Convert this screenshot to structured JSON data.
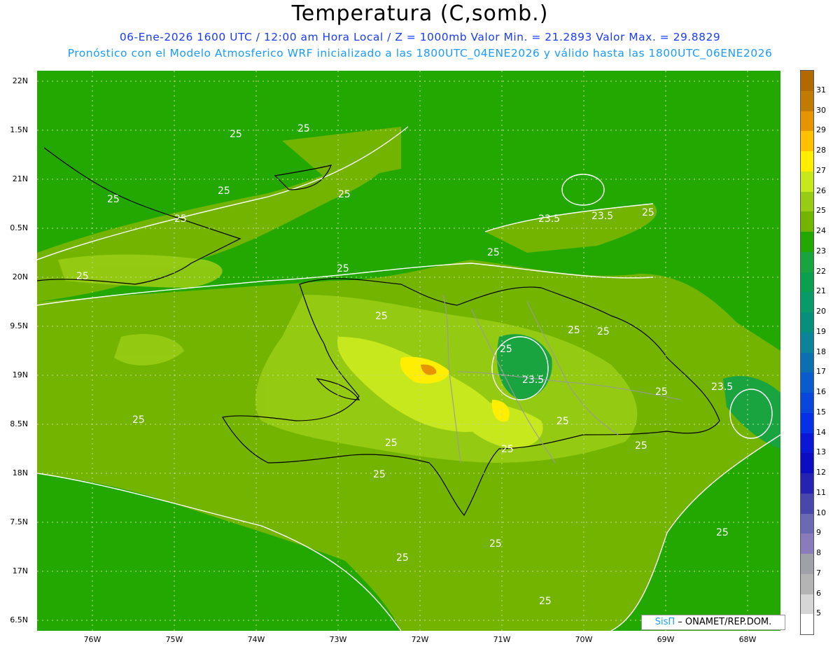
{
  "title": "Temperatura (C,somb.)",
  "subtitle_line1": "06-Ene-2026 1600 UTC / 12:00 am Hora Local / Z = 1000mb  Valor Min. = 21.2893  Valor Max. = 29.8829",
  "subtitle_line2": "Pronóstico con el Modelo Atmosferico WRF inicializado a las 1800UTC_04ENE2026 y válido hasta las  1800UTC_06ENE2026",
  "lat_labels": [
    "22N",
    "1.5N",
    "21N",
    "0.5N",
    "20N",
    "9.5N",
    "19N",
    "8.5N",
    "18N",
    "7.5N",
    "17N",
    "6.5N"
  ],
  "lon_labels": [
    "76W",
    "75W",
    "74W",
    "73W",
    "72W",
    "71W",
    "70W",
    "69W",
    "68W"
  ],
  "contour_labels": [
    "25",
    "25",
    "25",
    "25",
    "25",
    "25",
    "23.5",
    "23.5",
    "25",
    "25",
    "25",
    "25",
    "25",
    "25",
    "25",
    "23.5",
    "25",
    "23.5",
    "25",
    "25",
    "25",
    "25",
    "25",
    "25",
    "25",
    "25",
    "25",
    "25",
    "25"
  ],
  "colorbar": {
    "labels": [
      "31",
      "30",
      "29",
      "28",
      "27",
      "26",
      "25",
      "24",
      "23",
      "22",
      "21",
      "20",
      "19",
      "18",
      "17",
      "16",
      "15",
      "14",
      "13",
      "12",
      "11",
      "10",
      "9",
      "8",
      "7",
      "6",
      "5"
    ],
    "colors": [
      "#c07c00",
      "#e69500",
      "#ffc000",
      "#ffee00",
      "#c8e81e",
      "#98cc14",
      "#72b400",
      "#22a800",
      "#1aa440",
      "#0aa050",
      "#089a68",
      "#06907c",
      "#0a8496",
      "#0c70b0",
      "#0a5ccc",
      "#0846dc",
      "#0630e6",
      "#0a18d6",
      "#0c0cc0",
      "#2424b0",
      "#4848ac",
      "#6a6ab4",
      "#8a7cba",
      "#a0a0a8",
      "#b4b4b4",
      "#d6d6d6",
      "#ffffff"
    ]
  },
  "credit": {
    "logo": "SisΠ",
    "text": " ONAMET/REP.DOM."
  },
  "colors": {
    "base_green": "#22a800",
    "land_green": "#72b400",
    "warm_yellow": "#ffee00",
    "hot_orange": "#e69500",
    "title_blue": "#1a3cff",
    "subtitle_blue": "#1a9bff"
  }
}
